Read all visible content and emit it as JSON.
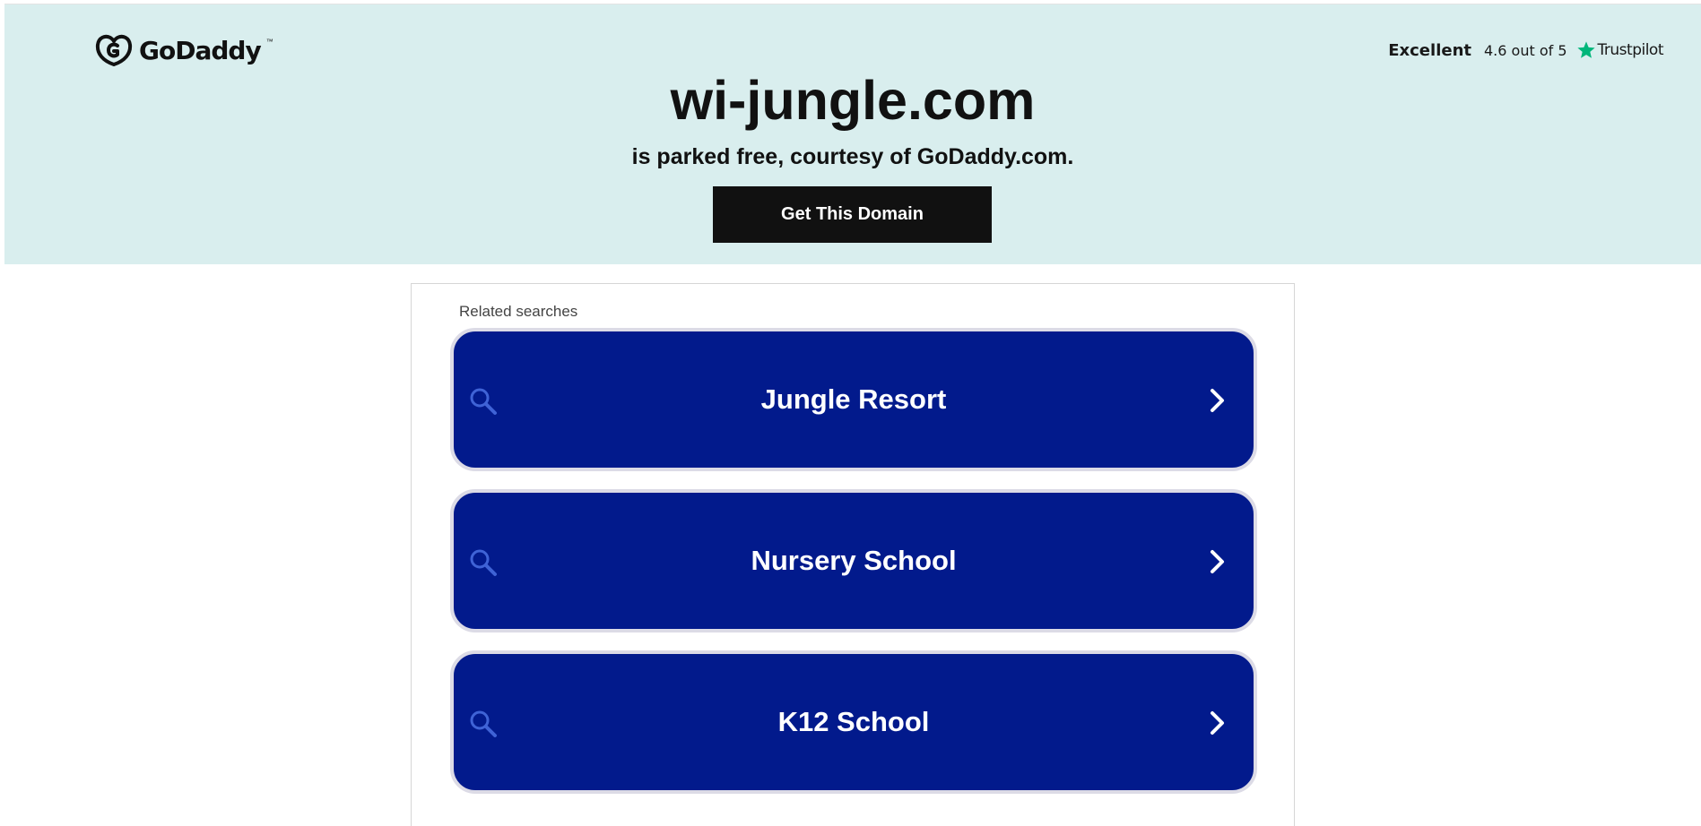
{
  "header": {
    "brand": "GoDaddy",
    "brand_tm": "™",
    "rating_label": "Excellent",
    "rating_score": "4.6 out of 5",
    "rating_brand": "Trustpilot",
    "domain": "wi-jungle.com",
    "subtitle": "is parked free, courtesy of GoDaddy.com.",
    "cta_label": "Get This Domain"
  },
  "related": {
    "label": "Related searches",
    "items": [
      {
        "label": "Jungle Resort",
        "icon": "search-icon",
        "arrow": "chevron-right-icon"
      },
      {
        "label": "Nursery School",
        "icon": "search-icon",
        "arrow": "chevron-right-icon"
      },
      {
        "label": "K12 School",
        "icon": "search-icon",
        "arrow": "chevron-right-icon"
      }
    ]
  },
  "colors": {
    "header_bg": "#d9eeee",
    "button_bg": "#111111",
    "result_bg": "#021a8c",
    "trustpilot_star": "#00b67a",
    "search_icon": "#3f63d6"
  }
}
